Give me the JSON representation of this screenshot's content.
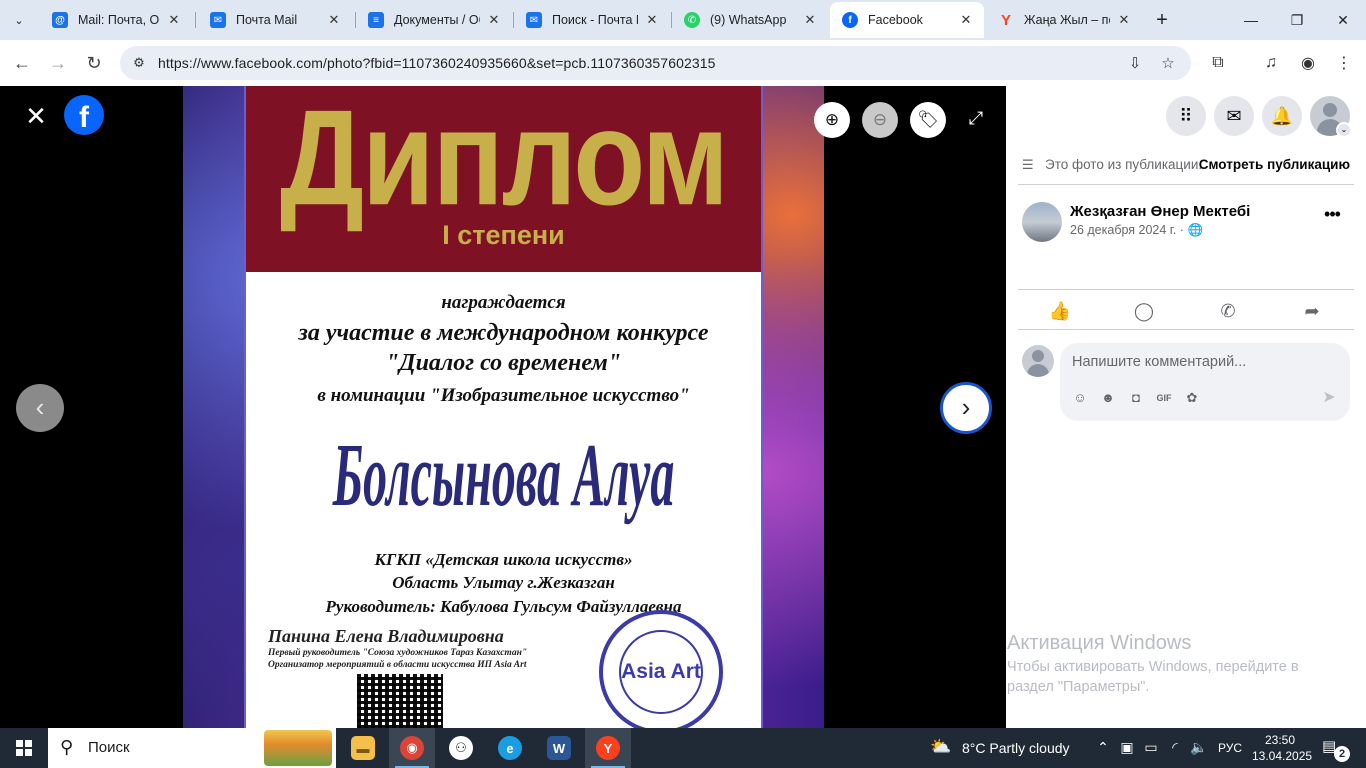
{
  "browser": {
    "tabs": [
      {
        "label": "Mail: Почта, Обл",
        "icon": "mail-at-icon",
        "color": "#1a73e8"
      },
      {
        "label": "Почта Mail",
        "icon": "mail-envelope-icon",
        "color": "#1a73e8"
      },
      {
        "label": "Документы / Об",
        "icon": "document-icon",
        "color": "#1a73e8"
      },
      {
        "label": "Поиск - Почта М",
        "icon": "mail-envelope-icon",
        "color": "#1a73e8"
      },
      {
        "label": "(9) WhatsApp",
        "icon": "whatsapp-icon",
        "color": "#25d366"
      },
      {
        "label": "Facebook",
        "icon": "facebook-icon",
        "color": "#0866ff",
        "active": true
      },
      {
        "label": "Жаңа Жыл – пе",
        "icon": "yandex-icon",
        "color": "#fc3f1d"
      }
    ],
    "url": "https://www.facebook.com/photo?fbid=1107360240935660&set=pcb.1107360357602315"
  },
  "viewer": {
    "diploma": {
      "title": "Диплом",
      "degree": "I степени",
      "line1": "награждается",
      "line2": "за участие в международном конкурсе",
      "line3": "\"Диалог со временем\"",
      "line4": "в номинации \"Изобразительное искусство\"",
      "recipient": "Болсынова Алуа",
      "org1": "КГКП «Детская школа искусств»",
      "org2": "Область Улытау  г.Жезказган",
      "org3": "Руководитель: Кабулова Гульсум Файзуллаевна",
      "signer": "Панина Елена Владимировна",
      "signer_role1": "Первый руководитель \"Союза художников Тараз Казахстан\"",
      "signer_role2": "Организатор мероприятий в области искусства ИП Asia Art",
      "stamp_text": "Asia Art"
    }
  },
  "panel": {
    "post_info_text": "Это фото из публикации.",
    "post_info_link": "Смотреть публикацию",
    "author_name": "Жезқазған Өнер Мектебі",
    "date": "26 декабря 2024 г. ·",
    "comment_placeholder": "Напишите комментарий...",
    "activation_title": "Активация Windows",
    "activation_text": "Чтобы активировать Windows, перейдите в раздел \"Параметры\"."
  },
  "taskbar": {
    "search_label": "Поиск",
    "weather": "8°C  Partly cloudy",
    "language": "РУС",
    "time": "23:50",
    "date": "13.04.2025",
    "notifications": "2"
  }
}
